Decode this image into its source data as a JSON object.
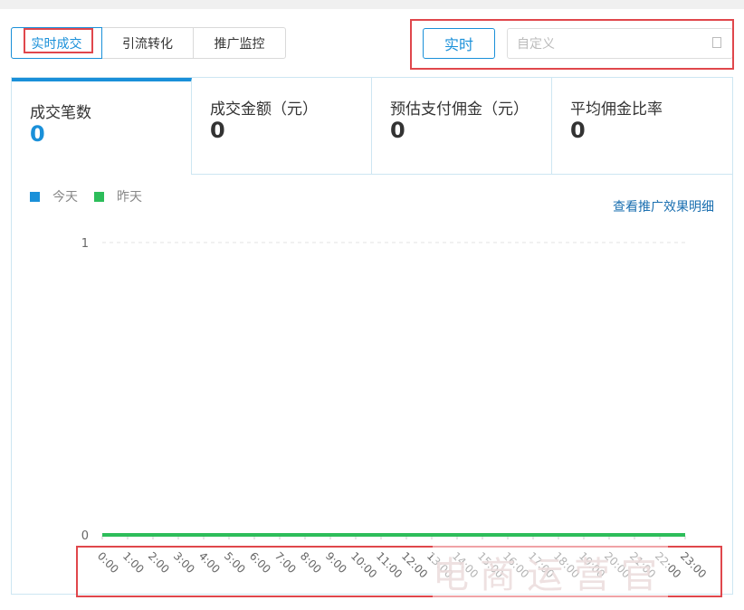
{
  "segments": [
    {
      "label": "实时成交",
      "active": true
    },
    {
      "label": "引流转化"
    },
    {
      "label": "推广监控"
    }
  ],
  "realtime_button": "实时",
  "date_input": {
    "placeholder": "自定义",
    "icon": "calendar-icon"
  },
  "metrics": [
    {
      "label": "成交笔数",
      "value": "0",
      "active": true
    },
    {
      "label": "成交金额（元）",
      "value": "0"
    },
    {
      "label": "预估支付佣金（元）",
      "value": "0"
    },
    {
      "label": "平均佣金比率",
      "value": "0"
    }
  ],
  "detail_link": "查看推广效果明细",
  "watermark": "电商运营官",
  "colors": {
    "accent": "#1a90d9",
    "today": "#1a90d9",
    "yesterday": "#2dbd5a",
    "highlight": "#e0474c"
  },
  "chart_data": {
    "type": "line",
    "x": [
      "0:00",
      "1:00",
      "2:00",
      "3:00",
      "4:00",
      "5:00",
      "6:00",
      "7:00",
      "8:00",
      "9:00",
      "10:00",
      "11:00",
      "12:00",
      "13:00",
      "14:00",
      "15:00",
      "16:00",
      "17:00",
      "18:00",
      "19:00",
      "20:00",
      "21:00",
      "22:00",
      "23:00"
    ],
    "series": [
      {
        "name": "今天",
        "color": "#1a90d9",
        "values": [
          0,
          0,
          0,
          0,
          0,
          0,
          0,
          0,
          0,
          0,
          0,
          0,
          0,
          0,
          0,
          0,
          0,
          0,
          0,
          0,
          0,
          0,
          0,
          0
        ]
      },
      {
        "name": "昨天",
        "color": "#2dbd5a",
        "values": [
          0,
          0,
          0,
          0,
          0,
          0,
          0,
          0,
          0,
          0,
          0,
          0,
          0,
          0,
          0,
          0,
          0,
          0,
          0,
          0,
          0,
          0,
          0,
          0
        ]
      }
    ],
    "yticks": [
      "0",
      "1"
    ],
    "ylim": [
      0,
      1
    ],
    "legend": "top-left",
    "grid": true
  }
}
